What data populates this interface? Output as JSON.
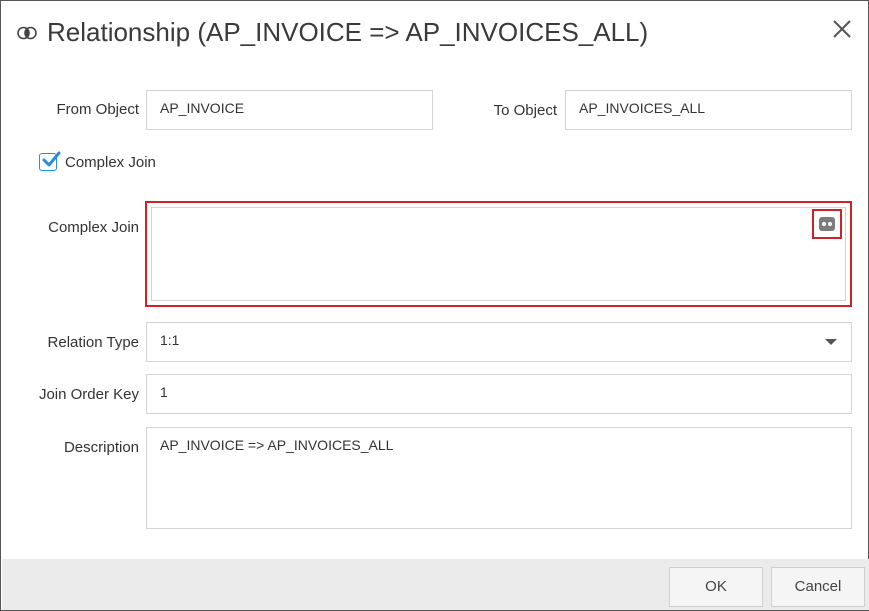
{
  "dialog": {
    "title": "Relationship (AP_INVOICE => AP_INVOICES_ALL)",
    "title_icon": "overlap-circles-icon",
    "close_icon": "close-icon"
  },
  "form": {
    "from_object": {
      "label": "From Object",
      "value": "AP_INVOICE"
    },
    "to_object": {
      "label": "To Object",
      "value": "AP_INVOICES_ALL"
    },
    "complex_join_checkbox": {
      "label": "Complex Join",
      "checked": true
    },
    "complex_join": {
      "label": "Complex Join",
      "value": "",
      "button_icon": "expression-editor-icon"
    },
    "relation_type": {
      "label": "Relation Type",
      "value": "1:1"
    },
    "join_order_key": {
      "label": "Join Order Key",
      "value": "1"
    },
    "description": {
      "label": "Description",
      "value": "AP_INVOICE => AP_INVOICES_ALL"
    }
  },
  "footer": {
    "ok_label": "OK",
    "cancel_label": "Cancel"
  },
  "colors": {
    "highlight": "#c8242b",
    "checkbox_accent": "#2f8ad8",
    "footer_bg": "#ebebeb"
  }
}
